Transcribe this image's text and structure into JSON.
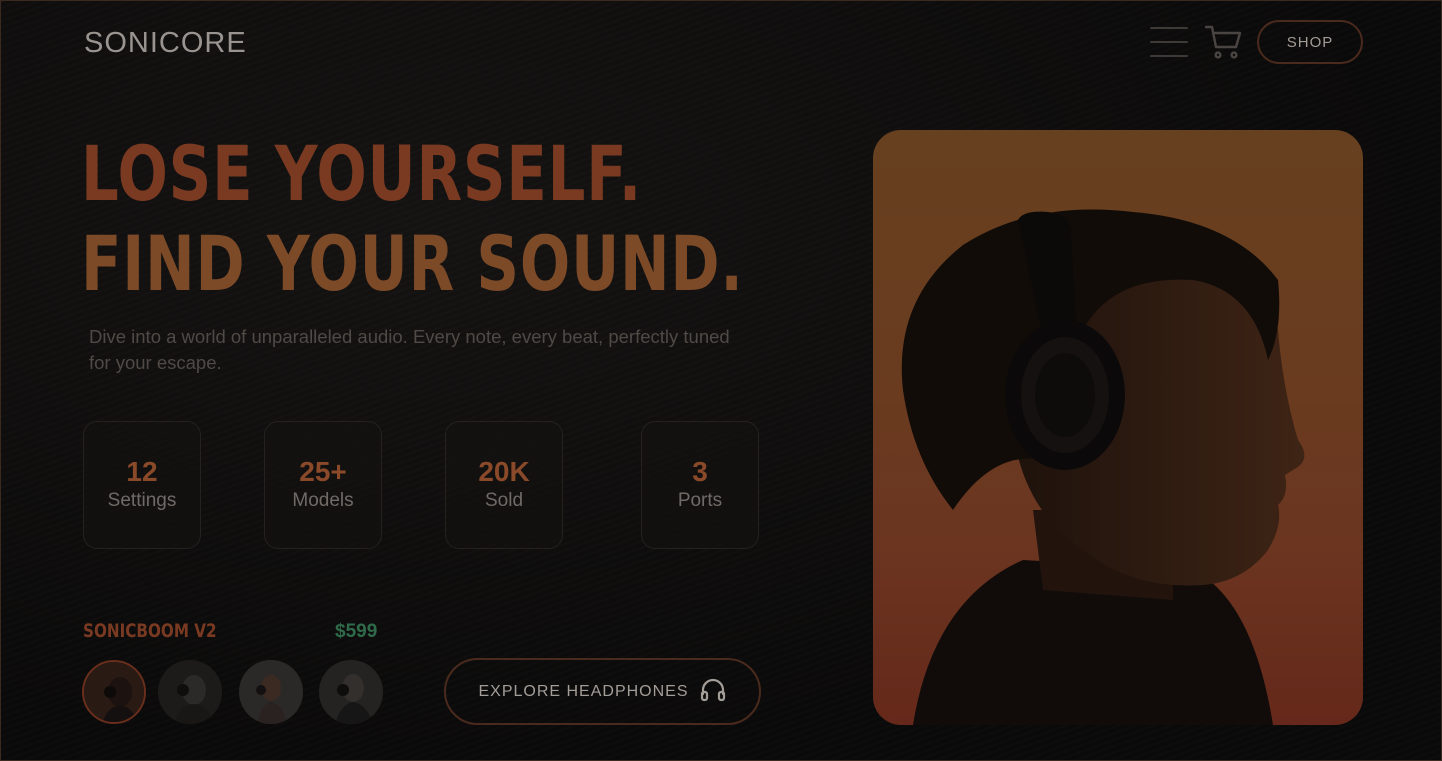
{
  "header": {
    "logo": "SONICORE",
    "menu_icon": "hamburger-menu-icon",
    "cart_icon": "shopping-cart-icon",
    "shop_label": "SHOP"
  },
  "hero": {
    "headline_line1": "LOSE YOURSELF.",
    "headline_line2": "FIND YOUR SOUND.",
    "subtext": "Dive into a world of unparalleled audio. Every note, every beat, perfectly tuned for your escape."
  },
  "stats": [
    {
      "value": "12",
      "label": "Settings"
    },
    {
      "value": "25+",
      "label": "Models"
    },
    {
      "value": "20K",
      "label": "Sold"
    },
    {
      "value": "3",
      "label": "Ports"
    }
  ],
  "product": {
    "name": "SONICBOOM V2",
    "price": "$599",
    "selected_thumbnail": 1
  },
  "cta": {
    "label": "EXPLORE HEADPHONES",
    "icon": "headphones-icon"
  },
  "colors": {
    "background": "#0d0c0c",
    "accent": "#7a3a22",
    "price": "#2f6b4a",
    "hero_top": "#66401f",
    "hero_bottom": "#65281a"
  }
}
